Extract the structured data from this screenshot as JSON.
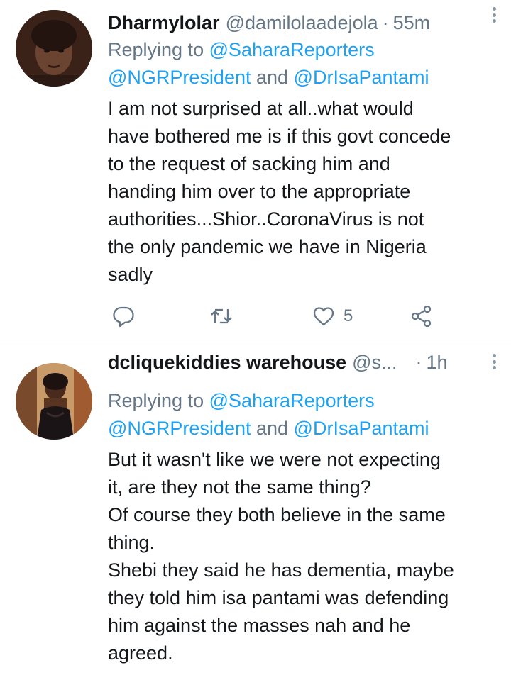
{
  "tweets": [
    {
      "display_name": "Dharmylolar",
      "handle": "@damilolaadejola",
      "separator": "·",
      "time": "55m",
      "replying_prefix": "Replying to ",
      "replying_mention_1": "@SaharaReporters",
      "replying_mention_2": "@NGRPresident",
      "replying_and": " and ",
      "replying_mention_3": "@DrIsaPantami",
      "body": "I am not surprised at all..what would\nhave bothered me is if this govt concede\nto the request of sacking him and\nhanding him over to the appropriate\nauthorities...Shior..CoronaVirus is not\nthe only pandemic we have in Nigeria\nsadly",
      "like_count": "5",
      "icons": [
        "reply-icon",
        "retweet-icon",
        "like-icon",
        "share-icon",
        "more-icon"
      ]
    },
    {
      "display_name": "dcliquekiddies warehouse",
      "handle": "@s...",
      "separator": "·",
      "time": "1h",
      "replying_prefix": "Replying to ",
      "replying_mention_1": "@SaharaReporters",
      "replying_mention_2": "@NGRPresident",
      "replying_and": " and ",
      "replying_mention_3": "@DrIsaPantami",
      "body": "But it wasn't like we were not expecting\nit, are they not the same thing?\nOf course they both believe in the same\nthing.\nShebi they said he has dementia, maybe\nthey told him isa pantami was defending\nhim against the masses nah and he\nagreed."
    }
  ],
  "colors": {
    "text": "#14171a",
    "secondary": "#657786",
    "link": "#1da1f2",
    "divider": "#e1e8ed"
  }
}
